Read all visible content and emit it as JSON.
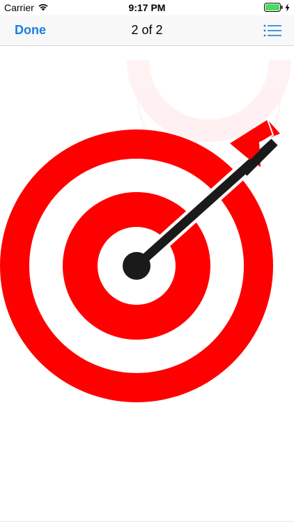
{
  "status_bar": {
    "carrier": "Carrier",
    "time": "9:17 PM",
    "battery_level": 1.0,
    "icons": [
      "wifi-icon",
      "battery-icon",
      "charging-bolt-icon"
    ]
  },
  "nav": {
    "done_label": "Done",
    "title": "2 of 2",
    "right_icon": "list-icon"
  },
  "content": {
    "image_subject": "dartboard-target-with-arrow"
  },
  "colors": {
    "accent": "#1a7fe0",
    "target_red": "#ff0000",
    "dart_black": "#1a1a1a",
    "battery_green": "#4cd964"
  }
}
